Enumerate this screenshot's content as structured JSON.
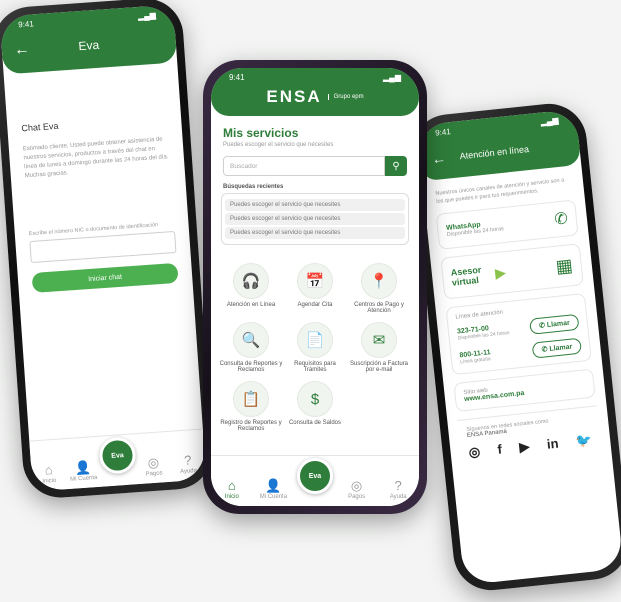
{
  "phone_left": {
    "status_time": "9:41",
    "appbar_title": "Eva",
    "chat_title": "Chat Eva",
    "intro_text": "Estimado cliente, Usted puede obtener asistencia de nuestros servicios, productos a través del chat en línea de lunes a domingo durante las 24 horas del día. Muchas gracias.",
    "field_label": "Escribe el número NIC o documento de identificación",
    "field_placeholder": "",
    "start_button": "Iniciar chat",
    "nav": [
      "Inicio",
      "Mi Cuenta",
      "Eva",
      "Pagos",
      "Ayuda"
    ]
  },
  "phone_center": {
    "status_time": "9:41",
    "logo": "ENSA",
    "logo_tagline": "Grupo epm",
    "title": "Mis servicios",
    "subtitle": "Puedes escoger el servicio que necesites",
    "search_placeholder": "Buscador",
    "recent_title": "Búsquedas recientes",
    "recent": [
      "Puedes escoger el servicio que necesites",
      "Puedes escoger el servicio que necesites",
      "Puedes escoger el servicio que necesites"
    ],
    "services": [
      {
        "icon": "headset-icon",
        "glyph": "🎧",
        "label": "Atención en Línea"
      },
      {
        "icon": "calendar-plus-icon",
        "glyph": "📅",
        "label": "Agendar Cita"
      },
      {
        "icon": "map-pin-icon",
        "glyph": "📍",
        "label": "Centros de Pago y Atención"
      },
      {
        "icon": "magnifier-icon",
        "glyph": "🔍",
        "label": "Consulta de Reportes y Reclamos"
      },
      {
        "icon": "document-icon",
        "glyph": "📄",
        "label": "Requisitos para Trámites"
      },
      {
        "icon": "mail-icon",
        "glyph": "✉",
        "label": "Suscripción a Factura por e-mail"
      },
      {
        "icon": "report-icon",
        "glyph": "📋",
        "label": "Registro de Reportes y Reclamos"
      },
      {
        "icon": "coin-icon",
        "glyph": "$",
        "label": "Consulta de Saldos"
      }
    ],
    "nav": [
      "Inicio",
      "Mi Cuenta",
      "Eva",
      "Pagos",
      "Ayuda"
    ]
  },
  "phone_right": {
    "status_time": "9:41",
    "appbar_title": "Atención en línea",
    "intro_text": "Nuestros únicos canales de atención y servicio son a los que puedes ir para tus requerimientos.",
    "whatsapp_title": "WhatsApp",
    "whatsapp_sub": "Disponible las 24 horas",
    "virtual_title": "Asesor virtual",
    "hours_title": "Línea de atención",
    "phone1": "323-71-00",
    "phone1_sub": "Disponible las 24 horas",
    "phone2": "800-11-11",
    "phone2_sub": "Línea gratuita",
    "call_label": "Llamar",
    "web_title": "Sitio web",
    "web_url": "www.ensa.com.pa",
    "social_title": "Síguenos en redes sociales como",
    "social_handle": "ENSA Panamá",
    "social": [
      "instagram-icon",
      "facebook-icon",
      "youtube-icon",
      "linkedin-icon",
      "twitter-icon"
    ]
  },
  "colors": {
    "brand_green": "#2e7d3a",
    "light_green": "#4caf50"
  }
}
